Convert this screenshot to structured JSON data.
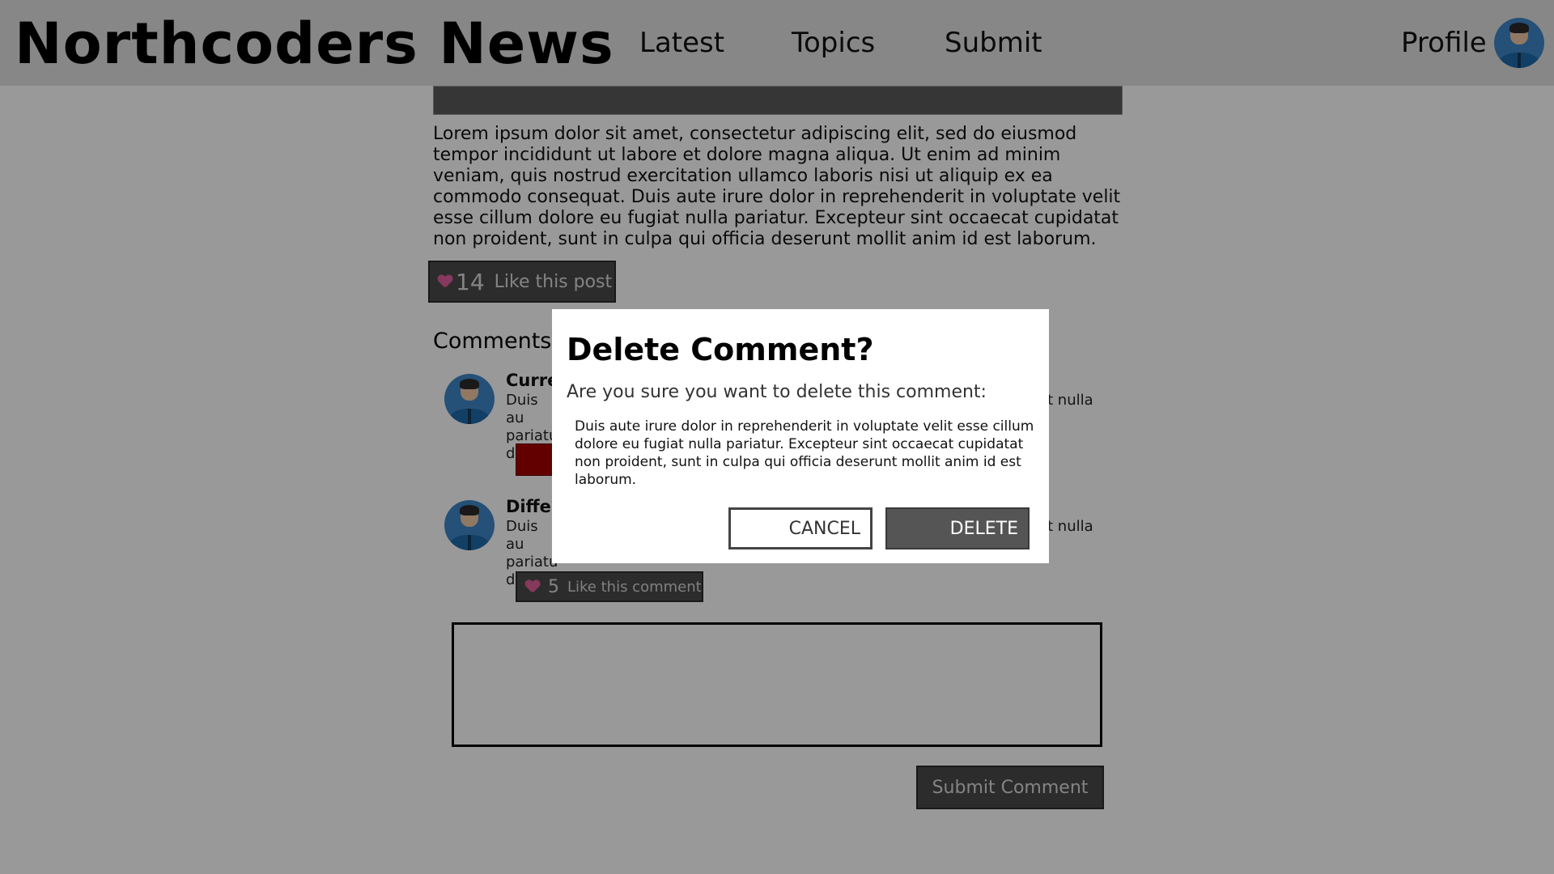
{
  "header": {
    "title": "Northcoders News",
    "nav": {
      "latest": "Latest",
      "topics": "Topics",
      "submit": "Submit"
    },
    "profile_label": "Profile"
  },
  "article": {
    "body": "Lorem ipsum dolor sit amet, consectetur adipiscing elit, sed do eiusmod tempor incididunt ut labore et dolore magna aliqua. Ut enim ad minim veniam, quis nostrud exercitation ullamco laboris nisi ut aliquip ex ea commodo consequat. Duis aute irure dolor in reprehenderit in voluptate velit esse cillum dolore eu fugiat nulla pariatur. Excepteur sint occaecat cupidatat non proident, sunt in culpa qui officia deserunt mollit anim id est laborum.",
    "likes": "14",
    "like_label": "Like this post"
  },
  "comments": {
    "heading": "Comments",
    "items": [
      {
        "author": "Curre",
        "text_left": "Duis au pariatu deseru",
        "text_right": "at nulla"
      },
      {
        "author": "Differ",
        "text_left": "Duis au pariatu deseru",
        "text_right": "at nulla",
        "likes": "5",
        "like_label": "Like this comment"
      }
    ],
    "input_value": "",
    "submit_label": "Submit Comment"
  },
  "modal": {
    "title": "Delete Comment?",
    "question": "Are you sure you want to delete this comment:",
    "quote": "Duis aute irure dolor in reprehenderit in voluptate velit esse cillum dolore eu fugiat nulla pariatur. Excepteur sint occaecat cupidatat non proident, sunt in culpa qui officia deserunt mollit anim id est laborum.",
    "cancel_label": "CANCEL",
    "delete_label": "DELETE"
  },
  "colors": {
    "header_bg": "#e2e2e2",
    "button_dark": "#4a4a4a",
    "delete_red": "#a30000",
    "heart_pink": "#e0609a",
    "avatar_blue": "#3f86c9"
  }
}
